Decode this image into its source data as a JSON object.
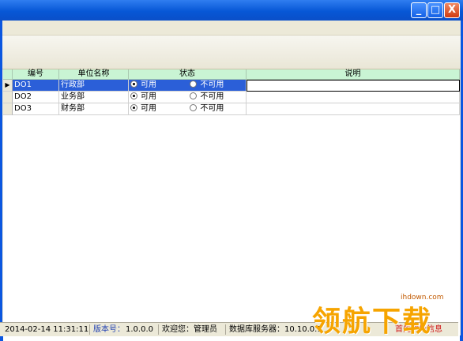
{
  "window": {
    "minimize": "_",
    "maximize": "□",
    "close": "X"
  },
  "grid": {
    "headers": [
      "编号",
      "单位名称",
      "状态",
      "说明"
    ],
    "rows": [
      {
        "code": "DO1",
        "name": "行政部",
        "status_on": "可用",
        "status_off": "不可用",
        "note": "",
        "selected": true
      },
      {
        "code": "DO2",
        "name": "业务部",
        "status_on": "可用",
        "status_off": "不可用",
        "note": "",
        "selected": false
      },
      {
        "code": "DO3",
        "name": "财务部",
        "status_on": "可用",
        "status_off": "不可用",
        "note": "",
        "selected": false
      }
    ]
  },
  "statusbar": {
    "datetime": "2014-02-14 11:31:11",
    "version_label": "版本号：",
    "version": "1.0.0.0",
    "welcome": "欢迎您：管理员",
    "db_server": "数据库服务器：10.10.0.1",
    "sync": "首先同步信息"
  },
  "watermark": {
    "text": "领航下载",
    "url": "ihdown.com"
  },
  "colors": {
    "title_blue": "#0757d6",
    "selection": "#2b5fd8",
    "grid_header": "#c9f4d4",
    "sync_red": "#d01818"
  }
}
